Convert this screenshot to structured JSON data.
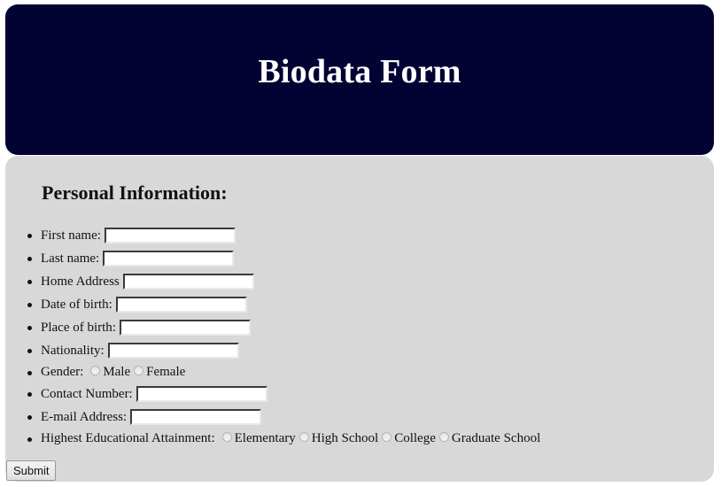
{
  "header": {
    "title": "Biodata Form",
    "background_color": "#020233"
  },
  "panel": {
    "background_color": "#d8d8d8",
    "section_title": "Personal Information:"
  },
  "fields": {
    "first_name": {
      "label": "First name:",
      "value": ""
    },
    "last_name": {
      "label": "Last name:",
      "value": ""
    },
    "home_address": {
      "label": "Home Address",
      "value": ""
    },
    "date_of_birth": {
      "label": "Date of birth:",
      "value": ""
    },
    "place_of_birth": {
      "label": "Place of birth:",
      "value": ""
    },
    "nationality": {
      "label": "Nationality:",
      "value": ""
    },
    "gender": {
      "label": "Gender:",
      "options": [
        "Male",
        "Female"
      ],
      "selected": null
    },
    "contact_number": {
      "label": "Contact Number:",
      "value": ""
    },
    "email_address": {
      "label": "E-mail Address:",
      "value": ""
    },
    "education": {
      "label": "Highest Educational Attainment:",
      "options": [
        "Elementary",
        "High School",
        "College",
        "Graduate School"
      ],
      "selected": null
    }
  },
  "actions": {
    "submit_label": "Submit"
  }
}
